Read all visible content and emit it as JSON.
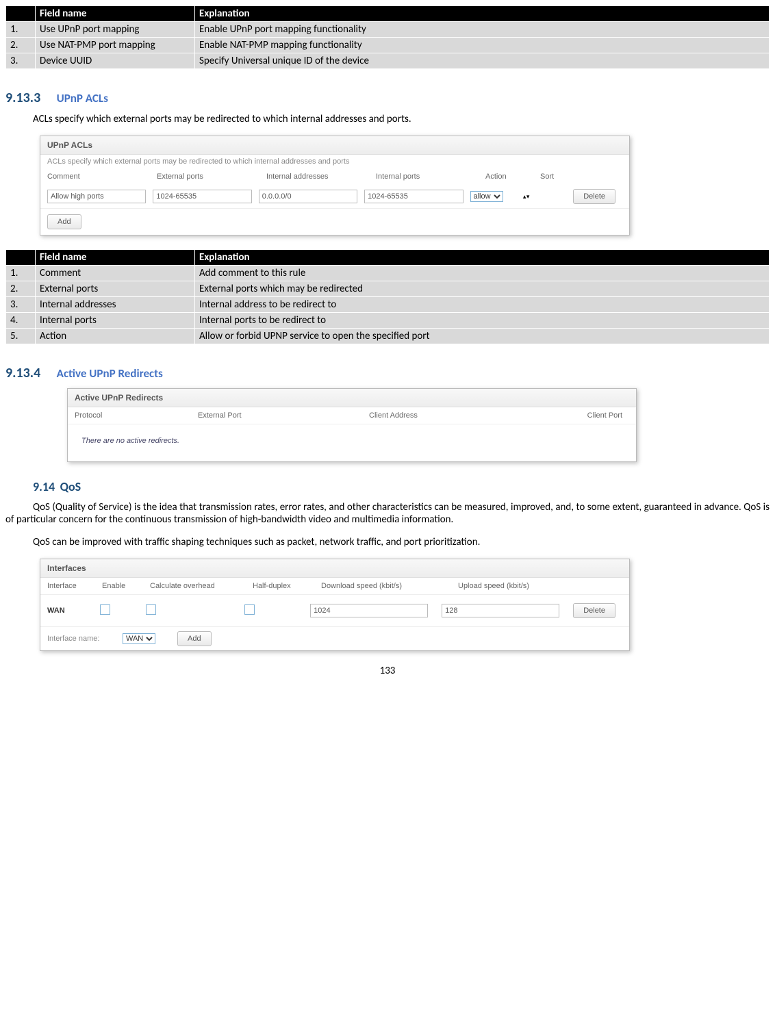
{
  "table1": {
    "headers": [
      "",
      "Field name",
      "Explanation"
    ],
    "rows": [
      {
        "n": "1.",
        "name": "Use UPnP port mapping",
        "exp": "Enable UPnP port mapping functionality"
      },
      {
        "n": "2.",
        "name": "Use NAT-PMP port mapping",
        "exp": "Enable NAT-PMP mapping functionality"
      },
      {
        "n": "3.",
        "name": "Device UUID",
        "exp": "Specify Universal unique ID of the device"
      }
    ]
  },
  "sec1": {
    "num": "9.13.3",
    "title": "UPnP ACLs"
  },
  "p1": "ACLs specify which external ports may be redirected to which internal addresses and ports.",
  "panel1": {
    "title": "UPnP ACLs",
    "sub": "ACLs specify which external ports may be redirected to which internal addresses and ports",
    "cols": [
      "Comment",
      "External ports",
      "Internal addresses",
      "Internal ports",
      "Action",
      "Sort"
    ],
    "row": {
      "comment": "Allow high ports",
      "ext": "1024-65535",
      "intaddr": "0.0.0.0/0",
      "intports": "1024-65535",
      "action_options": [
        "allow"
      ],
      "delete": "Delete"
    },
    "add": "Add"
  },
  "table2": {
    "headers": [
      "",
      "Field name",
      "Explanation"
    ],
    "rows": [
      {
        "n": "1.",
        "name": "Comment",
        "exp": "Add comment to this rule"
      },
      {
        "n": "2.",
        "name": "External ports",
        "exp": "External ports which may be redirected"
      },
      {
        "n": "3.",
        "name": "Internal addresses",
        "exp": "Internal address to be redirect to"
      },
      {
        "n": "4.",
        "name": "Internal ports",
        "exp": "Internal ports to be redirect to"
      },
      {
        "n": "5.",
        "name": "Action",
        "exp": "Allow or forbid UPNP service to open the specified port"
      }
    ]
  },
  "sec2": {
    "num": "9.13.4",
    "title": "Active UPnP Redirects"
  },
  "panel2": {
    "title": "Active UPnP Redirects",
    "cols": [
      "Protocol",
      "External Port",
      "Client Address",
      "Client Port"
    ],
    "empty": "There are no active redirects."
  },
  "sec3": {
    "num": "9.14",
    "title": "QoS"
  },
  "p2": "QoS (Quality of Service) is the idea that transmission rates, error rates, and other characteristics can be measured, improved, and, to some extent, guaranteed in advance. QoS is of particular concern for the continuous transmission of high-bandwidth video and multimedia information.",
  "p3": "QoS can be improved with traffic shaping techniques such as packet, network traffic, and port prioritization.",
  "panel3": {
    "title": "Interfaces",
    "cols": [
      "Interface",
      "Enable",
      "Calculate overhead",
      "Half-duplex",
      "Download speed (kbit/s)",
      "Upload speed (kbit/s)",
      ""
    ],
    "row": {
      "iface": "WAN",
      "dl": "1024",
      "ul": "128",
      "delete": "Delete"
    },
    "iface_label": "Interface name:",
    "iface_options": [
      "WAN"
    ],
    "add": "Add"
  },
  "page_number": "133"
}
